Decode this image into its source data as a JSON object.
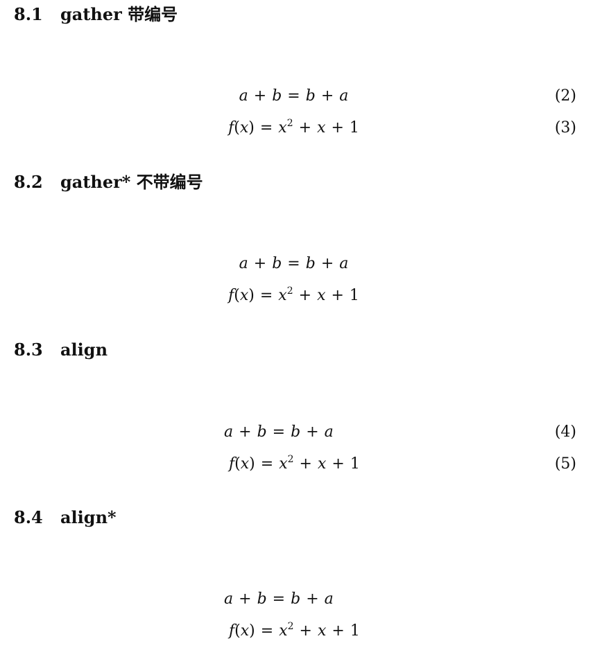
{
  "sections": [
    {
      "number": "8.1",
      "title": "gather 带编号",
      "equations": [
        {
          "tag": "(2)"
        },
        {
          "tag": "(3)"
        }
      ]
    },
    {
      "number": "8.2",
      "title": "gather* 不带编号",
      "equations": [
        {
          "tag": ""
        },
        {
          "tag": ""
        }
      ]
    },
    {
      "number": "8.3",
      "title": "align",
      "equations": [
        {
          "tag": "(4)"
        },
        {
          "tag": "(5)"
        }
      ]
    },
    {
      "number": "8.4",
      "title": "align*",
      "equations": [
        {
          "tag": ""
        },
        {
          "tag": ""
        }
      ]
    }
  ],
  "math": {
    "a": "a",
    "b": "b",
    "plus": "+",
    "equals": "=",
    "f": "f",
    "x": "x",
    "lparen": "(",
    "rparen": ")",
    "exp": "2",
    "one": "1"
  }
}
